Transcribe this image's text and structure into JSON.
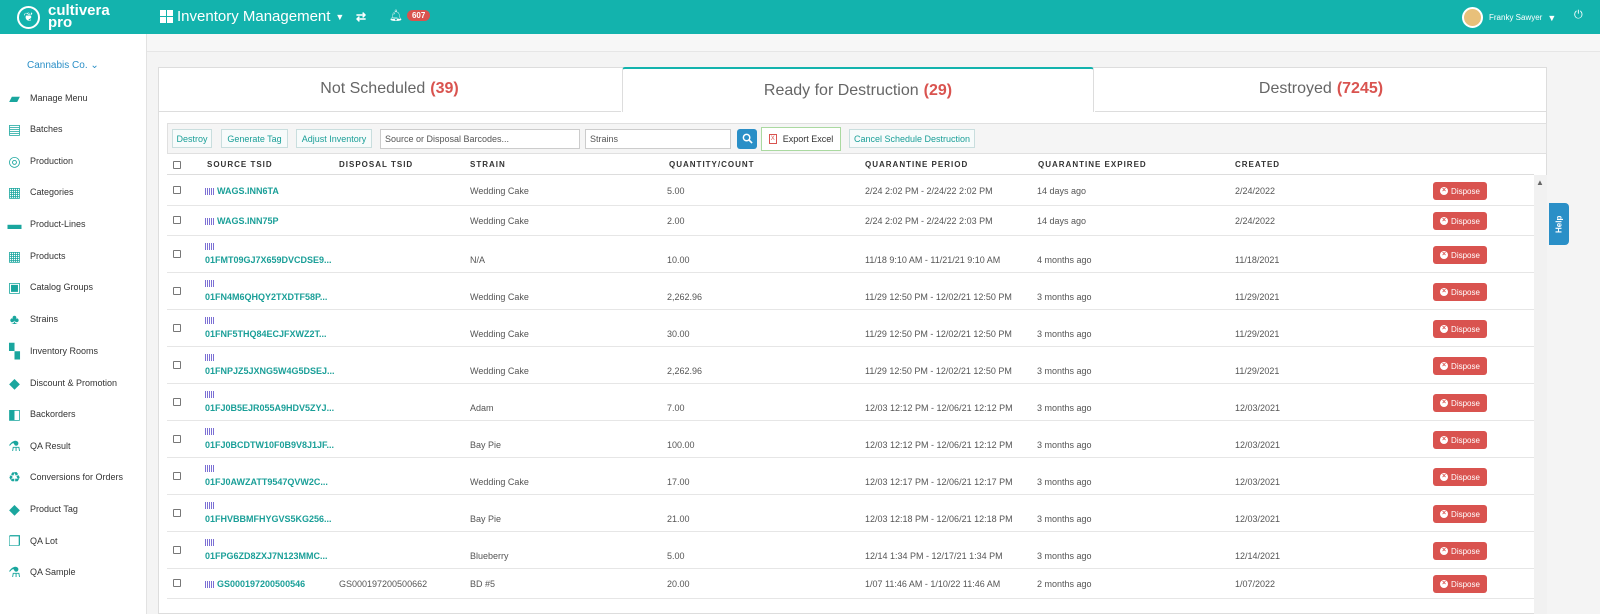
{
  "brand": {
    "line1": "cultivera",
    "line2": "pro"
  },
  "header": {
    "app_title": "Inventory Management",
    "notification_count": "607",
    "user_name": "Franky Sawyer"
  },
  "sidebar": {
    "company": "Cannabis Co. ⌄",
    "items": [
      {
        "label": "Manage Menu",
        "icon": "menu-book-icon"
      },
      {
        "label": "Batches",
        "icon": "batches-icon"
      },
      {
        "label": "Production",
        "icon": "production-icon"
      },
      {
        "label": "Categories",
        "icon": "categories-icon"
      },
      {
        "label": "Product-Lines",
        "icon": "product-lines-icon"
      },
      {
        "label": "Products",
        "icon": "products-icon"
      },
      {
        "label": "Catalog Groups",
        "icon": "catalog-groups-icon"
      },
      {
        "label": "Strains",
        "icon": "strains-icon"
      },
      {
        "label": "Inventory Rooms",
        "icon": "inventory-rooms-icon"
      },
      {
        "label": "Discount & Promotion",
        "icon": "tag-icon"
      },
      {
        "label": "Backorders",
        "icon": "backorders-icon"
      },
      {
        "label": "QA Result",
        "icon": "flask-icon"
      },
      {
        "label": "Conversions for Orders",
        "icon": "recycle-icon"
      },
      {
        "label": "Product Tag",
        "icon": "tag-icon"
      },
      {
        "label": "QA Lot",
        "icon": "qa-lot-icon"
      },
      {
        "label": "QA Sample",
        "icon": "flask-icon"
      }
    ]
  },
  "tabs": [
    {
      "label": "Not Scheduled",
      "count": "(39)"
    },
    {
      "label": "Ready for Destruction",
      "count": "(29)"
    },
    {
      "label": "Destroyed",
      "count": "(7245)"
    }
  ],
  "toolbar": {
    "destroy": "Destroy",
    "generate_tag": "Generate Tag",
    "adjust_inventory": "Adjust Inventory",
    "barcode_placeholder": "Source or Disposal Barcodes...",
    "strains_placeholder": "Strains",
    "export_excel": "Export Excel",
    "cancel_schedule": "Cancel Schedule Destruction"
  },
  "table": {
    "headers": {
      "source_tsid": "SOURCE TSID",
      "disposal_tsid": "DISPOSAL TSID",
      "strain": "STRAIN",
      "quantity": "QUANTITY/COUNT",
      "quarantine_period": "QUARANTINE PERIOD",
      "quarantine_expired": "QUARANTINE EXPIRED",
      "created": "CREATED"
    },
    "dispose_label": "Dispose",
    "rows": [
      {
        "source": "WAGS.INN6TA",
        "disposal": "",
        "strain": "Wedding Cake",
        "qty": "5.00",
        "period": "2/24 2:02 PM - 2/24/22 2:02 PM",
        "expired": "14 days ago",
        "created": "2/24/2022"
      },
      {
        "source": "WAGS.INN75P",
        "disposal": "",
        "strain": "Wedding Cake",
        "qty": "2.00",
        "period": "2/24 2:02 PM - 2/24/22 2:03 PM",
        "expired": "14 days ago",
        "created": "2/24/2022"
      },
      {
        "source": "01FMT09GJ7X659DVCDSE9...",
        "disposal": "",
        "strain": "N/A",
        "qty": "10.00",
        "period": "11/18 9:10 AM - 11/21/21 9:10 AM",
        "expired": "4 months ago",
        "created": "11/18/2021"
      },
      {
        "source": "01FN4M6QHQY2TXDTF58P...",
        "disposal": "",
        "strain": "Wedding Cake",
        "qty": "2,262.96",
        "period": "11/29 12:50 PM - 12/02/21 12:50 PM",
        "expired": "3 months ago",
        "created": "11/29/2021"
      },
      {
        "source": "01FNF5THQ84ECJFXWZ2T...",
        "disposal": "",
        "strain": "Wedding Cake",
        "qty": "30.00",
        "period": "11/29 12:50 PM - 12/02/21 12:50 PM",
        "expired": "3 months ago",
        "created": "11/29/2021"
      },
      {
        "source": "01FNPJZ5JXNG5W4G5DSEJ...",
        "disposal": "",
        "strain": "Wedding Cake",
        "qty": "2,262.96",
        "period": "11/29 12:50 PM - 12/02/21 12:50 PM",
        "expired": "3 months ago",
        "created": "11/29/2021"
      },
      {
        "source": "01FJ0B5EJR055A9HDV5ZYJ...",
        "disposal": "",
        "strain": "Adam",
        "qty": "7.00",
        "period": "12/03 12:12 PM - 12/06/21 12:12 PM",
        "expired": "3 months ago",
        "created": "12/03/2021"
      },
      {
        "source": "01FJ0BCDTW10F0B9V8J1JF...",
        "disposal": "",
        "strain": "Bay Pie",
        "qty": "100.00",
        "period": "12/03 12:12 PM - 12/06/21 12:12 PM",
        "expired": "3 months ago",
        "created": "12/03/2021"
      },
      {
        "source": "01FJ0AWZATT9547QVW2C...",
        "disposal": "",
        "strain": "Wedding Cake",
        "qty": "17.00",
        "period": "12/03 12:17 PM - 12/06/21 12:17 PM",
        "expired": "3 months ago",
        "created": "12/03/2021"
      },
      {
        "source": "01FHVBBMFHYGVS5KG256...",
        "disposal": "",
        "strain": "Bay Pie",
        "qty": "21.00",
        "period": "12/03 12:18 PM - 12/06/21 12:18 PM",
        "expired": "3 months ago",
        "created": "12/03/2021"
      },
      {
        "source": "01FPG6ZD8ZXJ7N123MMC...",
        "disposal": "",
        "strain": "Blueberry",
        "qty": "5.00",
        "period": "12/14 1:34 PM - 12/17/21 1:34 PM",
        "expired": "3 months ago",
        "created": "12/14/2021"
      },
      {
        "source": "GS000197200500546",
        "disposal": "GS000197200500662",
        "strain": "BD #5",
        "qty": "20.00",
        "period": "1/07 11:46 AM - 1/10/22 11:46 AM",
        "expired": "2 months ago",
        "created": "1/07/2022"
      }
    ]
  },
  "help_label": "Help"
}
